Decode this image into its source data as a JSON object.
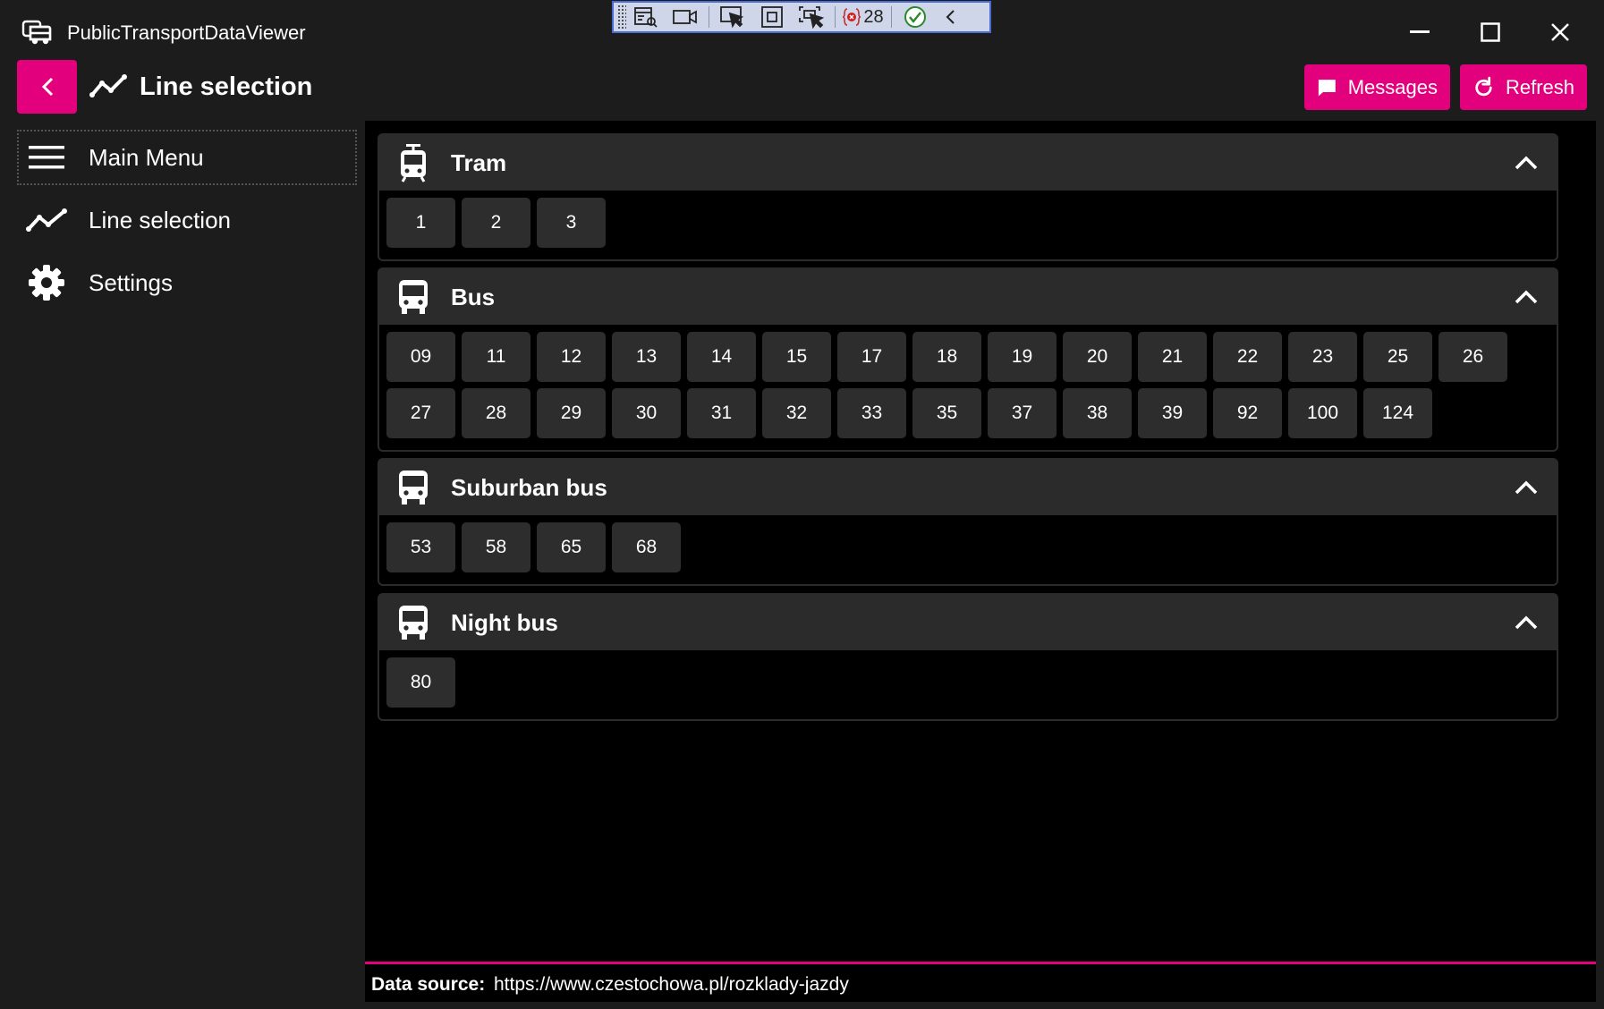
{
  "app": {
    "title": "PublicTransportDataViewer"
  },
  "debug_toolbar": {
    "count": "28"
  },
  "header": {
    "page_title": "Line selection",
    "messages_label": "Messages",
    "refresh_label": "Refresh"
  },
  "sidebar": {
    "items": [
      {
        "label": "Main Menu",
        "icon": "hamburger-menu-icon"
      },
      {
        "label": "Line selection",
        "icon": "line-chart-icon"
      },
      {
        "label": "Settings",
        "icon": "gear-icon"
      }
    ]
  },
  "groups": [
    {
      "title": "Tram",
      "icon": "tram-icon",
      "lines": [
        "1",
        "2",
        "3"
      ]
    },
    {
      "title": "Bus",
      "icon": "bus-icon",
      "lines": [
        "09",
        "11",
        "12",
        "13",
        "14",
        "15",
        "17",
        "18",
        "19",
        "20",
        "21",
        "22",
        "23",
        "25",
        "26",
        "27",
        "28",
        "29",
        "30",
        "31",
        "32",
        "33",
        "35",
        "37",
        "38",
        "39",
        "92",
        "100",
        "124"
      ]
    },
    {
      "title": "Suburban bus",
      "icon": "bus-icon",
      "lines": [
        "53",
        "58",
        "65",
        "68"
      ]
    },
    {
      "title": "Night bus",
      "icon": "bus-icon",
      "lines": [
        "80"
      ]
    }
  ],
  "footer": {
    "label": "Data source:",
    "url": "https://www.czestochowa.pl/rozklady-jazdy"
  },
  "colors": {
    "accent": "#e3007d",
    "panel": "#2b2b2b",
    "background": "#000000"
  }
}
